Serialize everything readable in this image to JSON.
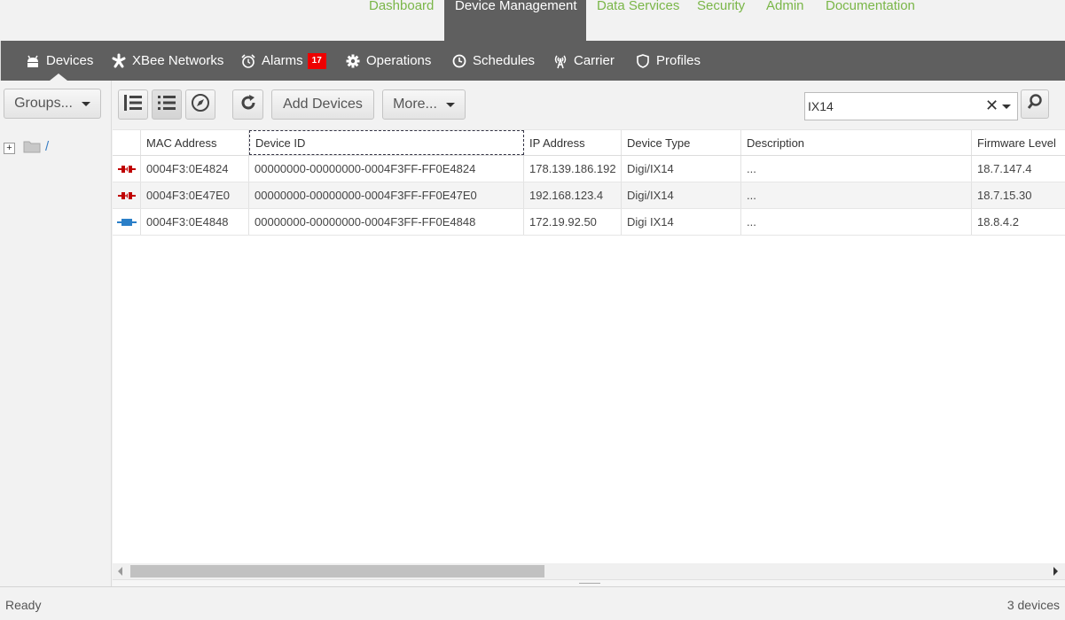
{
  "topnav": {
    "items": [
      {
        "label": "Dashboard"
      },
      {
        "label": "Device Management"
      },
      {
        "label": "Data Services"
      },
      {
        "label": "Security"
      },
      {
        "label": "Admin"
      },
      {
        "label": "Documentation"
      }
    ],
    "active_index": 1
  },
  "subnav": {
    "items": [
      {
        "label": "Devices",
        "icon": "android-icon"
      },
      {
        "label": "XBee Networks",
        "icon": "asterisk-icon"
      },
      {
        "label": "Alarms",
        "icon": "alarm-clock-icon",
        "badge": "17"
      },
      {
        "label": "Operations",
        "icon": "gear-icon"
      },
      {
        "label": "Schedules",
        "icon": "clock-icon"
      },
      {
        "label": "Carrier",
        "icon": "antenna-icon"
      },
      {
        "label": "Profiles",
        "icon": "shield-icon"
      }
    ]
  },
  "left": {
    "groups_label": "Groups...",
    "tree_root": "/"
  },
  "toolbar": {
    "add_devices_label": "Add Devices",
    "more_label": "More...",
    "search_value": "IX14"
  },
  "table": {
    "columns": [
      "MAC Address",
      "Device ID",
      "IP Address",
      "Device Type",
      "Description",
      "Firmware Level"
    ],
    "rows": [
      {
        "status": "disconnected",
        "mac": "0004F3:0E4824",
        "device_id": "00000000-00000000-0004F3FF-FF0E4824",
        "ip": "178.139.186.192",
        "type": "Digi/IX14",
        "description": "...",
        "firmware": "18.7.147.4"
      },
      {
        "status": "disconnected",
        "mac": "0004F3:0E47E0",
        "device_id": "00000000-00000000-0004F3FF-FF0E47E0",
        "ip": "192.168.123.4",
        "type": "Digi/IX14",
        "description": "...",
        "firmware": "18.7.15.30"
      },
      {
        "status": "connected",
        "mac": "0004F3:0E4848",
        "device_id": "00000000-00000000-0004F3FF-FF0E4848",
        "ip": "172.19.92.50",
        "type": "Digi IX14",
        "description": "...",
        "firmware": "18.8.4.2"
      }
    ]
  },
  "status": {
    "left": "Ready",
    "right": "3 devices"
  },
  "colors": {
    "nav_green": "#7ab648",
    "nav_dark": "#5f5f5f",
    "disconnected": "#c00000",
    "connected": "#2a7fc8",
    "badge": "#e00000"
  }
}
